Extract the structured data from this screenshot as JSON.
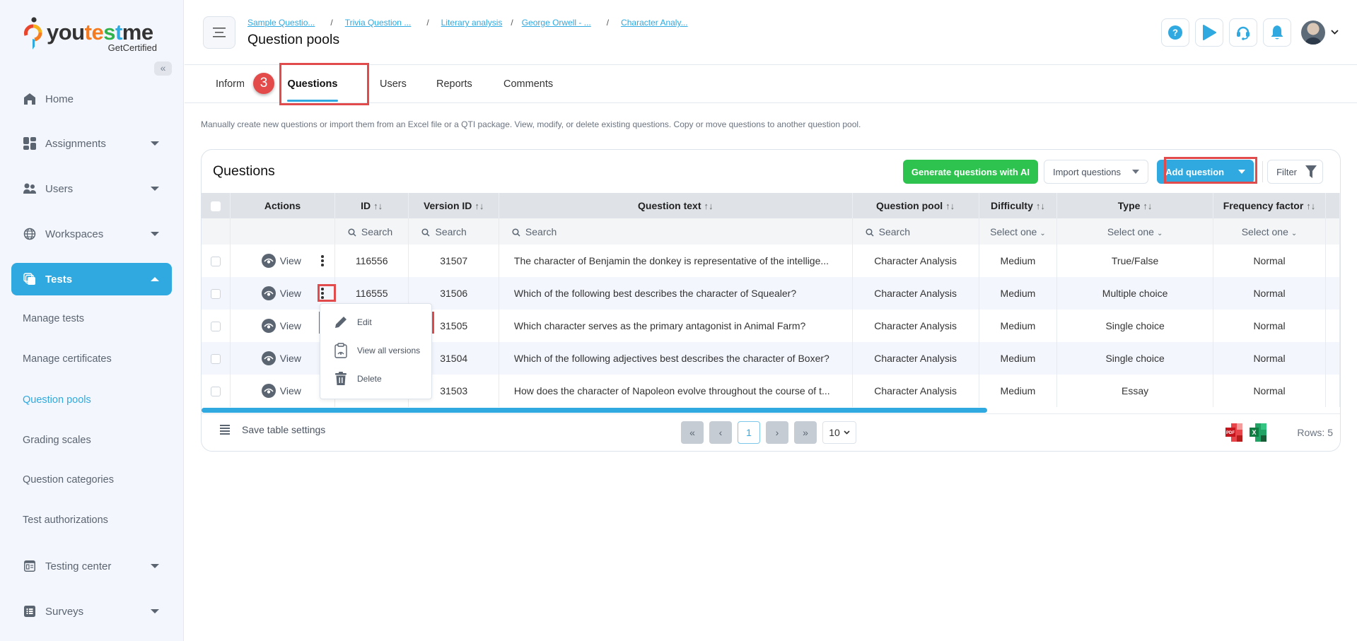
{
  "app": {
    "logo_word_parts": [
      "you",
      "t",
      "e",
      "s",
      "t",
      "me"
    ],
    "logo_word": "youtestme",
    "logo_tagline": "GetCertified",
    "collapse_icon": "«"
  },
  "sidebar": {
    "items": [
      {
        "label": "Home",
        "icon": "home-icon",
        "has_caret": false
      },
      {
        "label": "Assignments",
        "icon": "assignments-icon",
        "has_caret": true
      },
      {
        "label": "Users",
        "icon": "users-icon",
        "has_caret": true
      },
      {
        "label": "Workspaces",
        "icon": "globe-icon",
        "has_caret": true
      },
      {
        "label": "Tests",
        "icon": "tests-icon",
        "has_caret": true,
        "active": true
      },
      {
        "label": "Testing center",
        "icon": "testing-center-icon",
        "has_caret": true
      },
      {
        "label": "Surveys",
        "icon": "surveys-icon",
        "has_caret": true
      }
    ],
    "sub_items": [
      {
        "label": "Manage tests"
      },
      {
        "label": "Manage certificates"
      },
      {
        "label": "Question pools",
        "active": true
      },
      {
        "label": "Grading scales"
      },
      {
        "label": "Question categories"
      },
      {
        "label": "Test authorizations"
      }
    ]
  },
  "header": {
    "breadcrumbs": [
      "Sample Questio...",
      "Trivia Question ...",
      "Literary analysis",
      "George Orwell - ...",
      "Character Analy..."
    ],
    "breadcrumb_separator": "/",
    "title": "Question pools",
    "icons": [
      "help-icon",
      "play-icon",
      "support-headset-icon",
      "bell-icon"
    ],
    "avatar_caret": "⌄"
  },
  "tabs": {
    "items": [
      "Information",
      "Questions",
      "Users",
      "Reports",
      "Comments"
    ],
    "active": "Questions",
    "step_badge": "3"
  },
  "description": "Manually create new questions or import them from an Excel file or a QTI package. View, modify, or delete existing questions. Copy or move questions to another question pool.",
  "questions_card": {
    "title": "Questions",
    "buttons": {
      "generate_ai": "Generate questions with AI",
      "import": "Import questions",
      "add": "Add question",
      "filter": "Filter"
    },
    "columns": [
      "Actions",
      "ID",
      "Version ID",
      "Question text",
      "Question pool",
      "Difficulty",
      "Type",
      "Frequency factor"
    ],
    "sort_icon": "↑↓",
    "filters": {
      "search_placeholder": "Search",
      "select_placeholder": "Select one"
    },
    "view_label": "View",
    "rows": [
      {
        "id": "116556",
        "version_id": "31507",
        "text": "The character of Benjamin the donkey is representative of the intellige...",
        "pool": "Character Analysis",
        "difficulty": "Medium",
        "type": "True/False",
        "frequency": "Normal"
      },
      {
        "id": "116555",
        "version_id": "31506",
        "text": "Which of the following best describes the character of Squealer?",
        "pool": "Character Analysis",
        "difficulty": "Medium",
        "type": "Multiple choice",
        "frequency": "Normal"
      },
      {
        "id": "",
        "version_id": "31505",
        "text": "Which character serves as the primary antagonist in Animal Farm?",
        "pool": "Character Analysis",
        "difficulty": "Medium",
        "type": "Single choice",
        "frequency": "Normal"
      },
      {
        "id": "",
        "version_id": "31504",
        "text": "Which of the following adjectives best describes the character of Boxer?",
        "pool": "Character Analysis",
        "difficulty": "Medium",
        "type": "Single choice",
        "frequency": "Normal"
      },
      {
        "id": "",
        "version_id": "31503",
        "text": "How does the character of Napoleon evolve throughout the course of t...",
        "pool": "Character Analysis",
        "difficulty": "Medium",
        "type": "Essay",
        "frequency": "Normal"
      }
    ],
    "row_menu": {
      "items": [
        {
          "label": "Edit",
          "icon": "pencil-icon"
        },
        {
          "label": "View all versions",
          "icon": "clipboard-eye-icon"
        },
        {
          "label": "Delete",
          "icon": "trash-icon"
        }
      ]
    },
    "footer": {
      "save_settings": "Save table settings",
      "pagination": {
        "first": "«",
        "prev": "‹",
        "current": "1",
        "next": "›",
        "last": "»",
        "page_size": "10"
      },
      "exports": [
        "pdf-export-icon",
        "excel-export-icon"
      ],
      "rows_label": "Rows: 5"
    },
    "horizontal_scroll_fraction": 0.69
  },
  "colors": {
    "accent": "#2fa9e0",
    "green": "#2ec24f",
    "highlight": "#e14b4b",
    "sidebar_bg": "#f3f6fc"
  }
}
